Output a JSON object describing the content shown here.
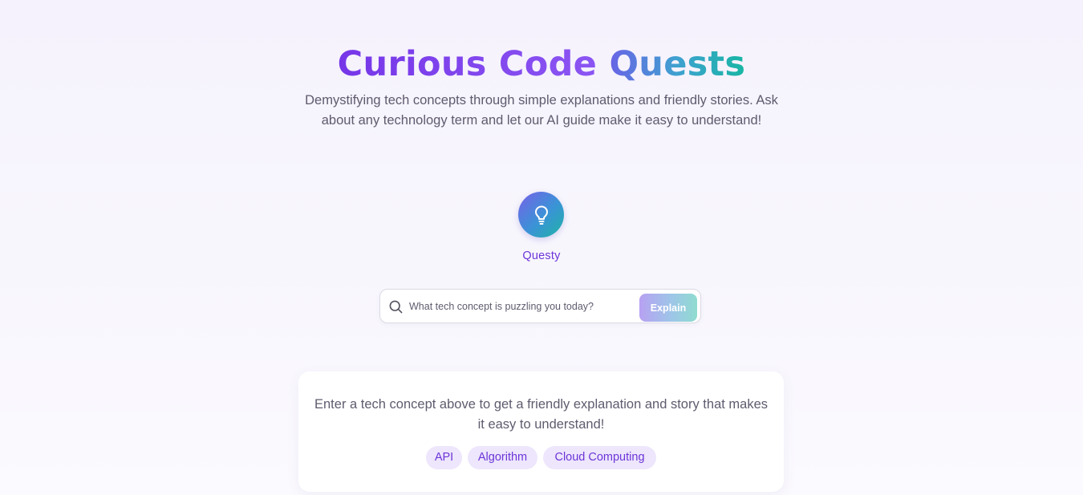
{
  "header": {
    "title_part1": "Curious Code",
    "title_part2": "Quests",
    "subtitle": "Demystifying tech concepts through simple explanations and friendly stories. Ask about any technology term and let our AI guide make it easy to understand!"
  },
  "guide": {
    "icon": "lightbulb-icon",
    "name": "Questy"
  },
  "search": {
    "icon": "search-icon",
    "placeholder": "What tech concept is puzzling you today?",
    "value": "",
    "button_label": "Explain"
  },
  "empty_state": {
    "message": "Enter a tech concept above to get a friendly explanation and story that makes it easy to understand!",
    "suggestions": [
      "API",
      "Algorithm",
      "Cloud Computing"
    ]
  },
  "colors": {
    "accent_purple": "#7c3aed",
    "accent_teal": "#18b6a4",
    "chip_bg": "#ede6fc",
    "text": "#5f5b6e"
  }
}
